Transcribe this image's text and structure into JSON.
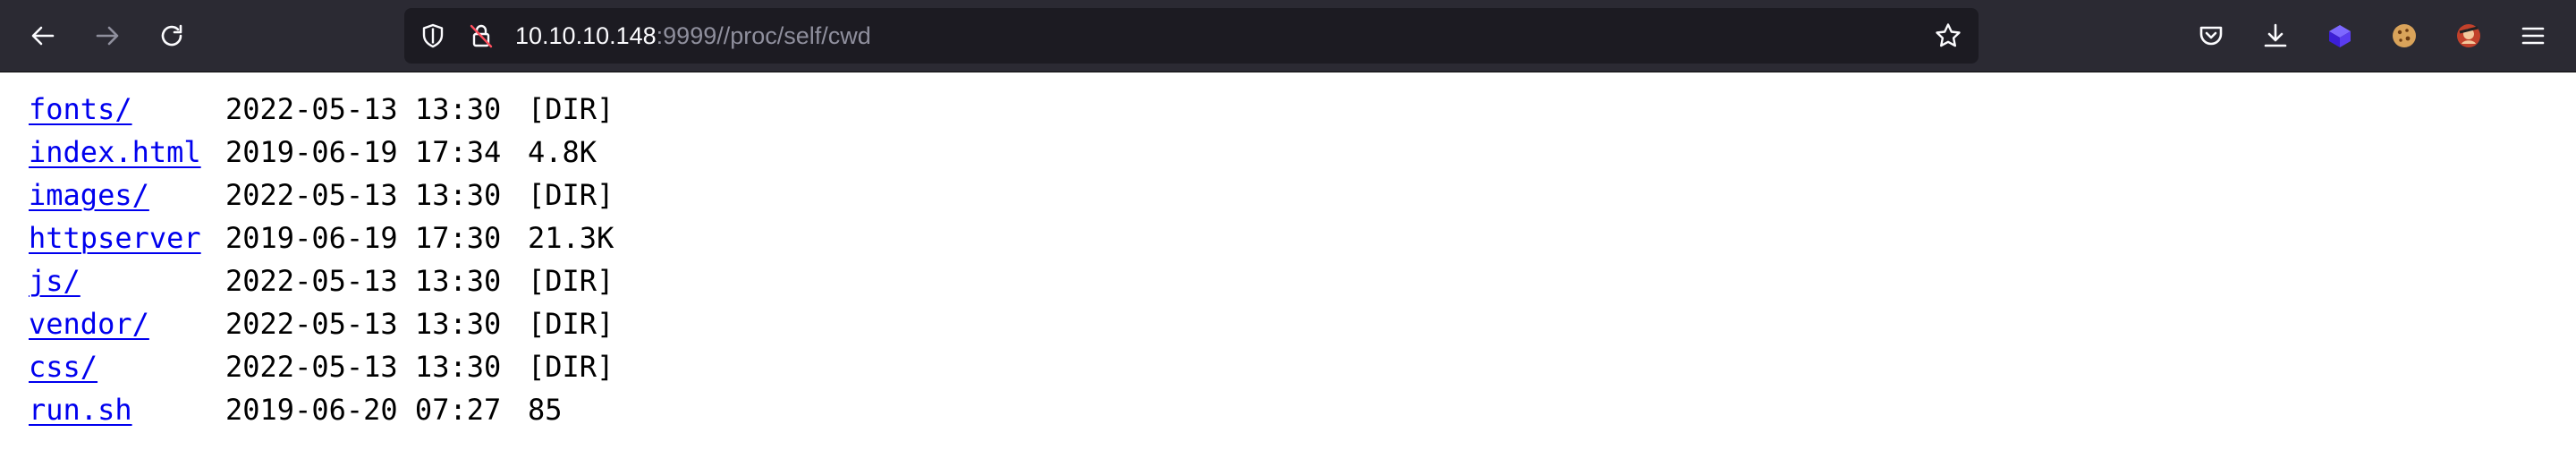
{
  "browser": {
    "url_host": "10.10.10.148",
    "url_rest": ":9999//proc/self/cwd",
    "colors": {
      "toolbar_bg": "#2b2a33",
      "urlbar_bg": "#1c1b22",
      "icon": "#fbfbfe",
      "link": "#0000ee"
    },
    "icons": {
      "back": "arrow-left-icon",
      "forward": "arrow-right-icon",
      "reload": "reload-icon",
      "tracking": "shield-icon",
      "insecure": "insecure-lock-icon",
      "bookmark": "star-icon",
      "pocket": "pocket-icon",
      "downloads": "download-icon",
      "extension1": "cube-extension-icon",
      "extension2": "cookie-icon",
      "extension3": "avatar-extension-icon",
      "menu": "hamburger-menu-icon"
    }
  },
  "listing": {
    "rows": [
      {
        "name": "fonts/",
        "date": "2022-05-13 13:30",
        "size": "[DIR]"
      },
      {
        "name": "index.html",
        "date": "2019-06-19 17:34",
        "size": "4.8K"
      },
      {
        "name": "images/",
        "date": "2022-05-13 13:30",
        "size": "[DIR]"
      },
      {
        "name": "httpserver",
        "date": "2019-06-19 17:30",
        "size": "21.3K"
      },
      {
        "name": "js/",
        "date": "2022-05-13 13:30",
        "size": "[DIR]"
      },
      {
        "name": "vendor/",
        "date": "2022-05-13 13:30",
        "size": "[DIR]"
      },
      {
        "name": "css/",
        "date": "2022-05-13 13:30",
        "size": "[DIR]"
      },
      {
        "name": "run.sh",
        "date": "2019-06-20 07:27",
        "size": "85"
      }
    ]
  }
}
